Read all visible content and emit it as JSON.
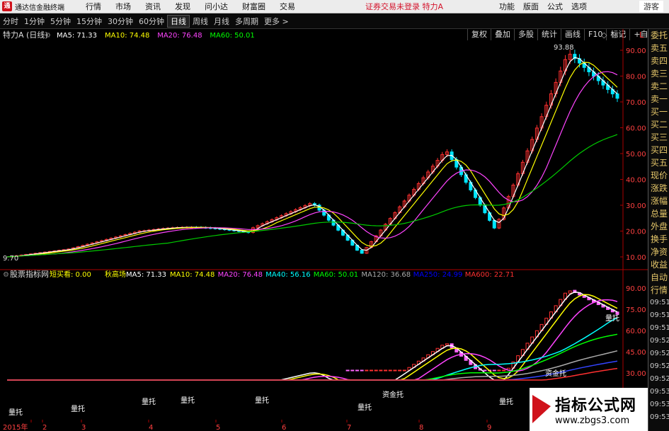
{
  "menubar": {
    "app_name": "通达信金融终端",
    "menus": [
      "行情",
      "市场",
      "资讯",
      "发现",
      "问小达",
      "财富圈",
      "交易"
    ],
    "login_warning": "证券交易未登录 特力A",
    "right_menus": [
      "功能",
      "版面",
      "公式",
      "选项"
    ],
    "guest": "游客"
  },
  "periodbar": {
    "tabs": [
      "分时",
      "1分钟",
      "5分钟",
      "15分钟",
      "30分钟",
      "60分钟",
      "日线",
      "周线",
      "月线",
      "多周期"
    ],
    "active": "日线",
    "more": "更多 >",
    "tools": [
      "复权",
      "叠加",
      "多股",
      "统计",
      "画线",
      "F10",
      "标记",
      "+自选"
    ]
  },
  "main_chart": {
    "title": "特力A (日线)",
    "ma": [
      {
        "label": "MA5: 71.33",
        "color": "#ffffff"
      },
      {
        "label": "MA10: 74.48",
        "color": "#ffff00"
      },
      {
        "label": "MA20: 76.48",
        "color": "#ff44ff"
      },
      {
        "label": "MA60: 50.01",
        "color": "#00ff00"
      }
    ],
    "high_label": "93.88",
    "low_label": "9.70",
    "y_ticks": [
      "90.00",
      "80.00",
      "70.00",
      "60.00",
      "50.00",
      "40.00",
      "30.00",
      "20.00",
      "10.00"
    ],
    "tag_right": "L"
  },
  "sub_chart": {
    "title": "股票指标网",
    "items": [
      {
        "label": "短买看: 0.00",
        "color": "#ffff00"
      },
      {
        "label": "秋高场",
        "color": "#ffff00"
      },
      {
        "label": "MA5: 71.33",
        "color": "#ffffff"
      },
      {
        "label": "MA10: 74.48",
        "color": "#ffff00"
      },
      {
        "label": "MA20: 76.48",
        "color": "#ff44ff"
      },
      {
        "label": "MA40: 56.16",
        "color": "#00ffff"
      },
      {
        "label": "MA60: 50.01",
        "color": "#00ff00"
      },
      {
        "label": "MA120: 36.68",
        "color": "#aaaaaa"
      },
      {
        "label": "MA250: 24.99",
        "color": "#0000ff"
      },
      {
        "label": "MA600: 22.71",
        "color": "#ff3030"
      }
    ],
    "y_ticks": [
      "90.00",
      "75.00",
      "60.00",
      "45.00",
      "30.00"
    ],
    "annotations": [
      "量托",
      "量托",
      "量托",
      "量托",
      "量托",
      "资金托",
      "量托",
      "量托",
      "资金托",
      "量托"
    ],
    "x_labels": [
      "2015年",
      "2",
      "3",
      "4",
      "5",
      "6",
      "7",
      "8",
      "9"
    ]
  },
  "right_panel": {
    "labels": [
      "委托",
      "卖五",
      "卖四",
      "卖三",
      "卖二",
      "卖一",
      "买一",
      "买二",
      "买三",
      "买四",
      "买五",
      "现价",
      "涨跌",
      "涨幅",
      "总量",
      "外盘",
      "换手",
      "净资",
      "收益"
    ],
    "tabs": [
      "自动",
      "行情"
    ],
    "times": [
      "09:51",
      "09:51",
      "09:51",
      "09:52",
      "09:52",
      "09:52",
      "09:52",
      "09:53",
      "09:53",
      "09:53"
    ]
  },
  "watermark": {
    "title": "指标公式网",
    "url": "www.zbgs3.com"
  }
}
